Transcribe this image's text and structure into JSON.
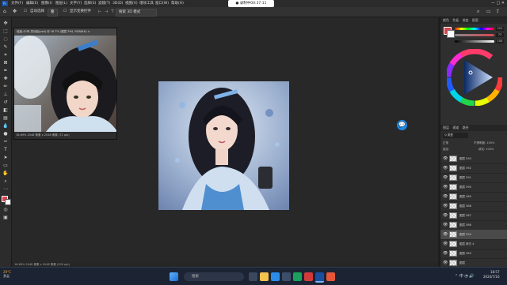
{
  "menubar": {
    "logo": "Ps",
    "items": [
      "文件(F)",
      "编辑(E)",
      "图像(I)",
      "图层(L)",
      "文字(Y)",
      "选择(S)",
      "滤镜(T)",
      "3D(D)",
      "视图(V)",
      "增效工具",
      "窗口(W)",
      "帮助(H)"
    ],
    "recording": "● 录制中00:37:11",
    "window_controls": "—  □  ✕"
  },
  "optbar": {
    "mode": "叠",
    "auto_select": "自动选择",
    "transform": "显示变换控件",
    "search_box": "搜索 3D 模式"
  },
  "float_doc": {
    "title": "瑶瑶-42号-灵动绘(psd) @ 16.7% (图层 594, RGB/8#) ×",
    "status": "16.69%  2048 像素 x 2048 像素 (72 ppi)"
  },
  "doc_status": "16.69%  2048 像素 x 2048 像素 (300 ppi)",
  "right_panel": {
    "tabs_top": [
      "颜色",
      "色板",
      "渐变",
      "图案"
    ],
    "color_values": [
      "221",
      "73",
      "100"
    ],
    "tabs_layers": [
      "图层",
      "通道",
      "路径"
    ],
    "filter_label": "Q 类型",
    "mode_label": "正常",
    "opacity_label": "不透明度: 100%",
    "lock_label": "锁定:",
    "fill_label": "填充: 100%",
    "layers": [
      {
        "name": "图层 593",
        "active": false
      },
      {
        "name": "图层 592",
        "active": false
      },
      {
        "name": "图层 591",
        "active": false
      },
      {
        "name": "图层 590",
        "active": false
      },
      {
        "name": "图层 589",
        "active": false
      },
      {
        "name": "图层 588",
        "active": false
      },
      {
        "name": "图层 587",
        "active": false
      },
      {
        "name": "图层 586",
        "active": false
      },
      {
        "name": "图层 594",
        "active": true
      },
      {
        "name": "图层 拷贝 4",
        "active": false
      },
      {
        "name": "图层 583",
        "active": false
      },
      {
        "name": "图层",
        "active": false
      }
    ]
  },
  "taskbar": {
    "weather_temp": "29°C",
    "weather_desc": "多云",
    "search": "搜索",
    "time": "18:57",
    "date": "2024/7/16"
  },
  "colors": {
    "accent": "#1e88e5",
    "fg_swatch": "#d64550",
    "bg_swatch": "#ffffff"
  }
}
